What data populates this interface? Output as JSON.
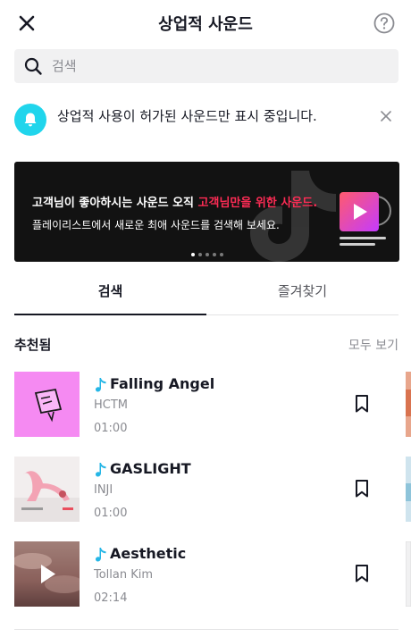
{
  "header": {
    "title": "상업적 사운드",
    "close_icon": "close-icon",
    "help_icon": "question-circle-icon"
  },
  "search": {
    "placeholder": "검색",
    "value": ""
  },
  "notice": {
    "text": "상업적 사용이 허가된 사운드만 표시 중입니다.",
    "icon": "bell-icon",
    "accent": "#20d5ec"
  },
  "banner": {
    "line1_part1": "고객님이 좋아하시는 사운드 오직 ",
    "line1_highlight": "고객님만을 위한 사운드.",
    "line2": "플레이리스트에서 새로운 최애 사운드를 검색해 보세요.",
    "highlight_color": "#fe2c55",
    "page_count": 5,
    "active_page": 1
  },
  "tabs": [
    {
      "label": "검색",
      "active": true
    },
    {
      "label": "즐겨찾기",
      "active": false
    }
  ],
  "section": {
    "title": "추천됨",
    "see_all": "모두 보기"
  },
  "tracks": [
    {
      "title": "Falling Angel",
      "artist": "HCTM",
      "duration": "01:00",
      "icon": "music-note-icon",
      "cover_color": "#f58af2"
    },
    {
      "title": "GASLIGHT",
      "artist": "INJI",
      "duration": "01:00",
      "icon": "music-note-icon",
      "cover_color": "#f2eeee"
    },
    {
      "title": "Aesthetic",
      "artist": "Tollan Kim",
      "duration": "02:14",
      "icon": "music-note-icon",
      "cover_color": "#9b6d6a"
    }
  ]
}
